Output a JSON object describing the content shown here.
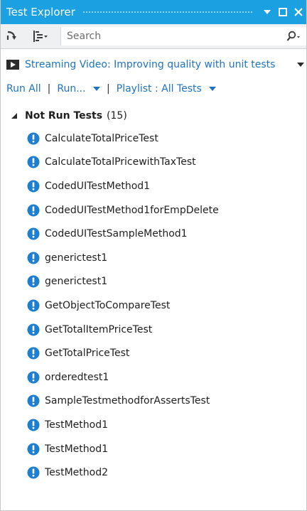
{
  "window": {
    "title": "Test Explorer"
  },
  "toolbar": {
    "search_placeholder": "Search"
  },
  "video_banner": {
    "text": "Streaming Video: Improving quality with unit tests"
  },
  "actions": {
    "run_all": "Run All",
    "run": "Run...",
    "playlist": "Playlist : All Tests",
    "separator": "|"
  },
  "group": {
    "title": "Not Run Tests",
    "count": "(15)"
  },
  "tests": [
    {
      "name": "CalculateTotalPriceTest"
    },
    {
      "name": "CalculateTotalPricewithTaxTest"
    },
    {
      "name": "CodedUITestMethod1"
    },
    {
      "name": "CodedUITestMethod1forEmpDelete"
    },
    {
      "name": "CodedUITestSampleMethod1"
    },
    {
      "name": "generictest1"
    },
    {
      "name": "generictest1"
    },
    {
      "name": "GetObjectToCompareTest"
    },
    {
      "name": "GetTotalItemPriceTest"
    },
    {
      "name": "GetTotalPriceTest"
    },
    {
      "name": "orderedtest1"
    },
    {
      "name": "SampleTestmethodforAssertsTest"
    },
    {
      "name": "TestMethod1"
    },
    {
      "name": "TestMethod1"
    },
    {
      "name": "TestMethod2"
    }
  ],
  "colors": {
    "title_bar": "#1ba1e2",
    "link": "#1e73be",
    "not_run_icon": "#1e7fd1",
    "toolbar_bg": "#eff0f2"
  },
  "icons": {
    "title_dropdown": "caret-down-icon",
    "title_maximize": "maximize-icon",
    "title_close": "close-icon",
    "toolbar_run": "run-arrow-icon",
    "toolbar_group": "group-by-icon",
    "search": "search-icon",
    "video": "video-icon",
    "group_expand": "expanded-triangle-icon",
    "test_status": "not-run-icon"
  }
}
